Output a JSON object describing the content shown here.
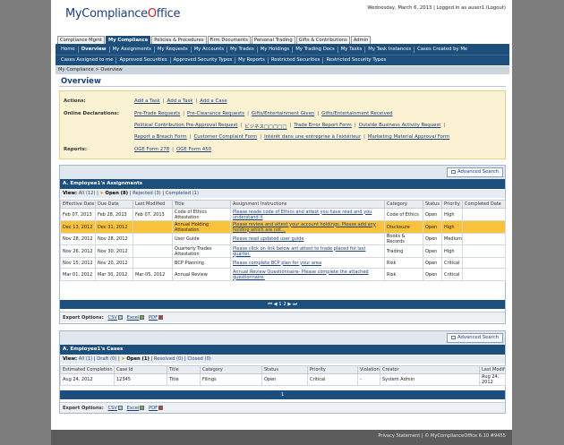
{
  "header": {
    "logo_text": "MyComplianceOffice",
    "top_right": "Wednesday, March 6, 2013 | Logged in as auser1 (Logout)"
  },
  "tabs": [
    "Compliance Mgmt",
    "My Compliance",
    "Policies & Procedures",
    "Firm Documents",
    "Personal Trading",
    "Gifts & Contributions",
    "Admin"
  ],
  "nav1": [
    "Home",
    "Overview",
    "My Assignments",
    "My Requests",
    "My Accounts",
    "My Trades",
    "My Holdings",
    "My Trading Docs",
    "My Tasks",
    "My Task Instances",
    "Cases Created by Me"
  ],
  "nav2": [
    "Cases Assigned to me",
    "Approved Securities",
    "Approved Security Types",
    "My Reports",
    "Restricted Securities",
    "Restricted Security Types"
  ],
  "breadcrumb": "My Compliance > Overview",
  "page_title": "Overview",
  "actions": {
    "label_actions": "Actions:",
    "actions_links": [
      "Add a Task",
      "Add a Task",
      "Add a Case"
    ],
    "label_online": "Online Declarations:",
    "online_row1": [
      "Pre-Trade Requests",
      "Pre-Clearance Requests",
      "Gifts/Entertainment Given",
      "Gifts/Entertainment Received"
    ],
    "online_row2": [
      "Political Contribution Pre-Approval Request",
      "ビジネス□□□□□",
      "Trade Error Report Form",
      "Outside Business Activity Request"
    ],
    "online_row3": [
      "Report a Breach Form",
      "Customer Complaint Form",
      "Intérêt dans une entreprise à l'extérieur",
      "Marketing Material Approval Form"
    ],
    "label_reports": "Reports:",
    "reports_links": [
      "OGE Form 278",
      "OGE Form 450"
    ]
  },
  "assignments": {
    "advanced_search": "Advanced Search",
    "title": "A. Employee1's Assignments",
    "filter_view": "View:",
    "filter_all": "All (12)",
    "filter_open": "Open (8)",
    "filter_rejected": "Rejected (3)",
    "filter_completed": "Completed (1)",
    "columns": [
      "Effective Date",
      "Due Date",
      "Last Modified",
      "Title",
      "Assignment Instructions",
      "Category",
      "Status",
      "Priority",
      "Completed Date"
    ],
    "rows": [
      [
        "Feb 07, 2013",
        "Feb 28, 2013",
        "Feb 07, 2013",
        "Code of Ethics Attestation",
        "Please reade code of Ethics and attest you have read and you understand it",
        "Code of Ethics",
        "Open",
        "High",
        ""
      ],
      [
        "Dec 13, 2012",
        "Dec 31, 2012",
        "",
        "Annual Holding Attestation",
        "Please review and attest your account holdings. Please add any holding which are not...",
        "Disclosure",
        "Open",
        "High",
        ""
      ],
      [
        "Nov 28, 2012",
        "Nov 28, 2012",
        "",
        "User Guide",
        "Please read updated user guide",
        "Books & Records",
        "Open",
        "Medium",
        ""
      ],
      [
        "Nov 26, 2012",
        "Nov 30, 2012",
        "",
        "Quarterly Trades Attestation",
        "Please click on link below ant attest to trade placed for last quarter.",
        "Trading",
        "Open",
        "High",
        ""
      ],
      [
        "Nov 15, 2012",
        "Nov 20, 2012",
        "",
        "BCP Planning",
        "Please complete BCP plan for your area",
        "Risk",
        "Open",
        "Critical",
        ""
      ],
      [
        "Mar 01, 2012",
        "Mar 30, 2012",
        "Mar 05, 2012",
        "Annual Review",
        "Annual Review Questionnaire- Please complete the attached questionnaire.",
        "Risk",
        "Open",
        "Critical",
        ""
      ]
    ],
    "pager": "⏮ ◀ 1 2 ▶ ⏭"
  },
  "export": {
    "label": "Export Options:",
    "csv": "CSV",
    "excel": "Excel",
    "pdf": "PDF"
  },
  "cases": {
    "advanced_search": "Advanced Search",
    "title": "A. Employee1's Cases",
    "filter_view": "View:",
    "filter_all": "All (1)",
    "filter_draft": "Draft (0)",
    "filter_open": "Open (1)",
    "filter_resolved": "Resolved (0)",
    "filter_closed": "Closed (0)",
    "columns": [
      "Estimated Completion",
      "Case Id",
      "Title",
      "Category",
      "Status",
      "Priority",
      "Violation",
      "Creator",
      "Last Modified"
    ],
    "rows": [
      [
        "Aug 24, 2012",
        "12345",
        "Title",
        "Filings",
        "Open",
        "Critical",
        "-",
        "System Admin",
        "Aug 24, 2012"
      ]
    ],
    "pager": "1"
  },
  "footer": "Privacy Statement | © MyComplianceOffice 6.10 #9455"
}
